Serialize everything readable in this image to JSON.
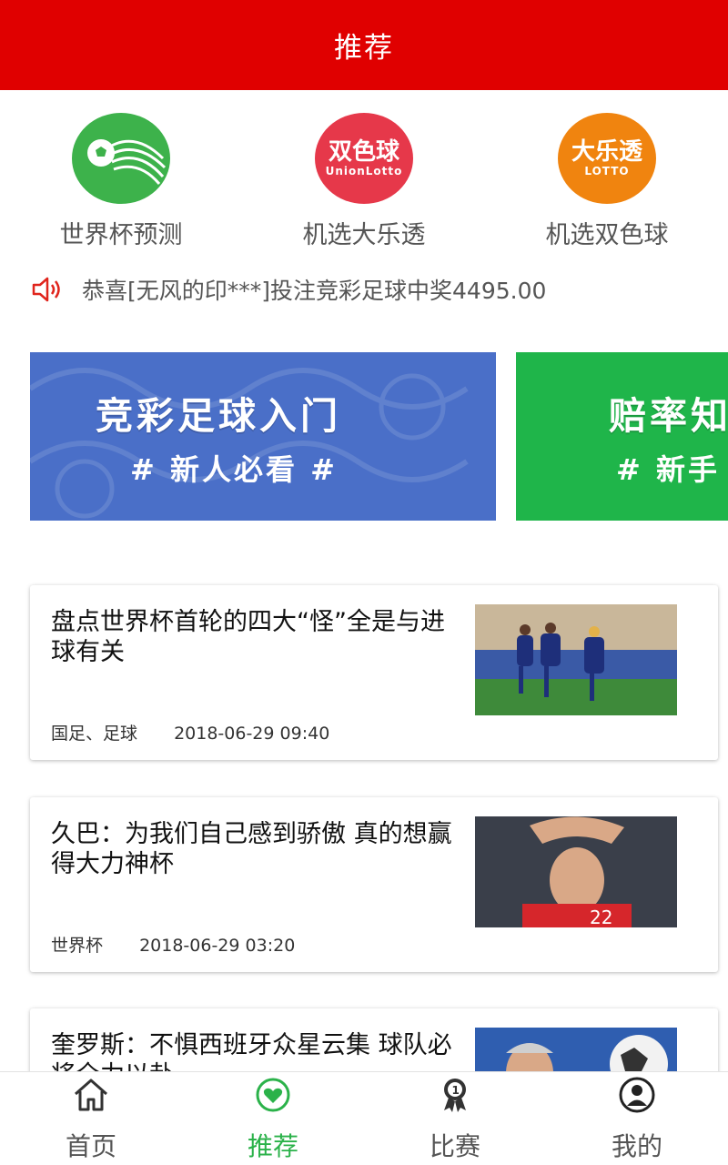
{
  "header": {
    "title": "推荐"
  },
  "quick_entries": [
    {
      "label": "世界杯预测",
      "icon": "soccer-ball-icon",
      "color": "#3db24b"
    },
    {
      "label": "机选大乐透",
      "icon": "union-lotto-logo",
      "logo_text": "双色球",
      "logo_sub": "UnionLotto",
      "color": "#e6384a"
    },
    {
      "label": "机选双色球",
      "icon": "lotto-logo",
      "logo_text": "大乐透",
      "logo_sub": "LOTTO",
      "color": "#f0840f"
    }
  ],
  "notice": {
    "icon": "speaker-icon",
    "text": "恭喜[无风的印***]投注竞彩足球中奖4495.00"
  },
  "banners": [
    {
      "title": "竞彩足球入门",
      "subtitle": "# 新人必看 #",
      "color": "#4a6fc8"
    },
    {
      "title": "赔率知",
      "subtitle": "# 新手",
      "color": "#1fb54a"
    }
  ],
  "news": [
    {
      "title": "盘点世界杯首轮的四大“怪”全是与进球有关",
      "tag": "国足、足球",
      "time": "2018-06-29 09:40"
    },
    {
      "title": "久巴：为我们自己感到骄傲 真的想赢得大力神杯",
      "tag": "世界杯",
      "time": "2018-06-29 03:20"
    },
    {
      "title": "奎罗斯：不惧西班牙众星云集 球队必将全力以赴",
      "tag": "",
      "time": ""
    }
  ],
  "tabbar": [
    {
      "label": "首页",
      "icon": "home-icon",
      "active": false
    },
    {
      "label": "推荐",
      "icon": "heart-icon",
      "active": true
    },
    {
      "label": "比赛",
      "icon": "medal-icon",
      "active": false
    },
    {
      "label": "我的",
      "icon": "user-icon",
      "active": false
    }
  ],
  "colors": {
    "header": "#e00000",
    "active_tab": "#2bb24a"
  }
}
